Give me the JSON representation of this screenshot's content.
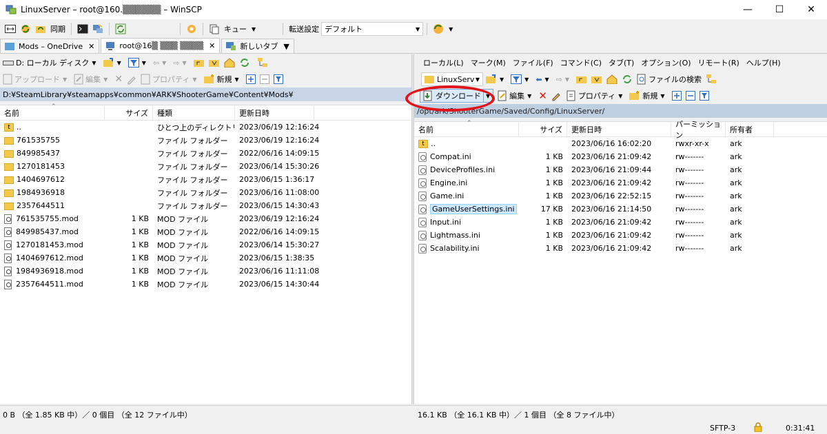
{
  "window": {
    "title": "LinuxServer – root@160.▒▒▒▒▒▒ – WinSCP"
  },
  "toolbar1": {
    "sync": "同期",
    "queue": "キュー",
    "transfer_settings_label": "転送設定",
    "transfer_settings_value": "デフォルト"
  },
  "tabs": [
    {
      "label": "Mods – OneDrive"
    },
    {
      "label": "root@16▒ ▒▒▒ ▒▒▒▒"
    },
    {
      "label": "新しいタブ"
    }
  ],
  "left": {
    "drive": "D: ローカル ディスク",
    "upload": "アップロード",
    "edit": "編集",
    "properties": "プロパティ",
    "new": "新規",
    "path": "D:¥SteamLibrary¥steamapps¥common¥ARK¥ShooterGame¥Content¥Mods¥",
    "headers": {
      "name": "名前",
      "size": "サイズ",
      "type": "種類",
      "modified": "更新日時"
    },
    "rows": [
      {
        "name": "..",
        "size": "",
        "type": "ひとつ上のディレクトリ",
        "modified": "2023/06/19 12:16:24",
        "icon": "parent"
      },
      {
        "name": "761535755",
        "size": "",
        "type": "ファイル フォルダー",
        "modified": "2023/06/19 12:16:24",
        "icon": "folder"
      },
      {
        "name": "849985437",
        "size": "",
        "type": "ファイル フォルダー",
        "modified": "2022/06/16 14:09:15",
        "icon": "folder"
      },
      {
        "name": "1270181453",
        "size": "",
        "type": "ファイル フォルダー",
        "modified": "2023/06/14 15:30:26",
        "icon": "folder"
      },
      {
        "name": "1404697612",
        "size": "",
        "type": "ファイル フォルダー",
        "modified": "2023/06/15 1:36:17",
        "icon": "folder"
      },
      {
        "name": "1984936918",
        "size": "",
        "type": "ファイル フォルダー",
        "modified": "2023/06/16 11:08:00",
        "icon": "folder"
      },
      {
        "name": "2357644511",
        "size": "",
        "type": "ファイル フォルダー",
        "modified": "2023/06/15 14:30:43",
        "icon": "folder"
      },
      {
        "name": "761535755.mod",
        "size": "1 KB",
        "type": "MOD ファイル",
        "modified": "2023/06/19 12:16:24",
        "icon": "mod"
      },
      {
        "name": "849985437.mod",
        "size": "1 KB",
        "type": "MOD ファイル",
        "modified": "2022/06/16 14:09:15",
        "icon": "mod"
      },
      {
        "name": "1270181453.mod",
        "size": "1 KB",
        "type": "MOD ファイル",
        "modified": "2023/06/14 15:30:27",
        "icon": "mod"
      },
      {
        "name": "1404697612.mod",
        "size": "1 KB",
        "type": "MOD ファイル",
        "modified": "2023/06/15 1:38:35",
        "icon": "mod"
      },
      {
        "name": "1984936918.mod",
        "size": "1 KB",
        "type": "MOD ファイル",
        "modified": "2023/06/16 11:11:08",
        "icon": "mod"
      },
      {
        "name": "2357644511.mod",
        "size": "1 KB",
        "type": "MOD ファイル",
        "modified": "2023/06/15 14:30:44",
        "icon": "mod"
      }
    ],
    "status": "0 B （全 1.85 KB 中）／ 0 個目 （全 12 ファイル中）"
  },
  "right": {
    "menu": [
      "ローカル(L)",
      "マーク(M)",
      "ファイル(F)",
      "コマンド(C)",
      "タブ(T)",
      "オプション(O)",
      "リモート(R)",
      "ヘルプ(H)"
    ],
    "server_combo": "LinuxServ",
    "find_files": "ファイルの検索",
    "download": "ダウンロード",
    "edit": "編集",
    "properties": "プロパティ",
    "new": "新規",
    "path": "/opt/ark/ShooterGame/Saved/Config/LinuxServer/",
    "headers": {
      "name": "名前",
      "size": "サイズ",
      "modified": "更新日時",
      "permissions": "パーミッション",
      "owner": "所有者"
    },
    "rows": [
      {
        "name": "..",
        "size": "",
        "modified": "2023/06/16 16:02:20",
        "permissions": "rwxr-xr-x",
        "owner": "ark",
        "icon": "parent"
      },
      {
        "name": "Compat.ini",
        "size": "1 KB",
        "modified": "2023/06/16 21:09:42",
        "permissions": "rw-------",
        "owner": "ark",
        "icon": "ini"
      },
      {
        "name": "DeviceProfiles.ini",
        "size": "1 KB",
        "modified": "2023/06/16 21:09:44",
        "permissions": "rw-------",
        "owner": "ark",
        "icon": "ini"
      },
      {
        "name": "Engine.ini",
        "size": "1 KB",
        "modified": "2023/06/16 21:09:42",
        "permissions": "rw-------",
        "owner": "ark",
        "icon": "ini"
      },
      {
        "name": "Game.ini",
        "size": "1 KB",
        "modified": "2023/06/16 22:52:15",
        "permissions": "rw-------",
        "owner": "ark",
        "icon": "ini"
      },
      {
        "name": "GameUserSettings.ini",
        "size": "17 KB",
        "modified": "2023/06/16 21:14:50",
        "permissions": "rw-------",
        "owner": "ark",
        "icon": "ini",
        "selected": true
      },
      {
        "name": "Input.ini",
        "size": "1 KB",
        "modified": "2023/06/16 21:09:42",
        "permissions": "rw-------",
        "owner": "ark",
        "icon": "ini"
      },
      {
        "name": "Lightmass.ini",
        "size": "1 KB",
        "modified": "2023/06/16 21:09:42",
        "permissions": "rw-------",
        "owner": "ark",
        "icon": "ini"
      },
      {
        "name": "Scalability.ini",
        "size": "1 KB",
        "modified": "2023/06/16 21:09:42",
        "permissions": "rw-------",
        "owner": "ark",
        "icon": "ini"
      }
    ],
    "status": "16.1 KB （全 16.1 KB 中）／ 1 個目 （全 8 ファイル中）"
  },
  "status": {
    "protocol": "SFTP-3",
    "time": "0:31:41"
  },
  "colors": {
    "highlight_ring": "#e0151c",
    "selection": "#cce8ff"
  }
}
